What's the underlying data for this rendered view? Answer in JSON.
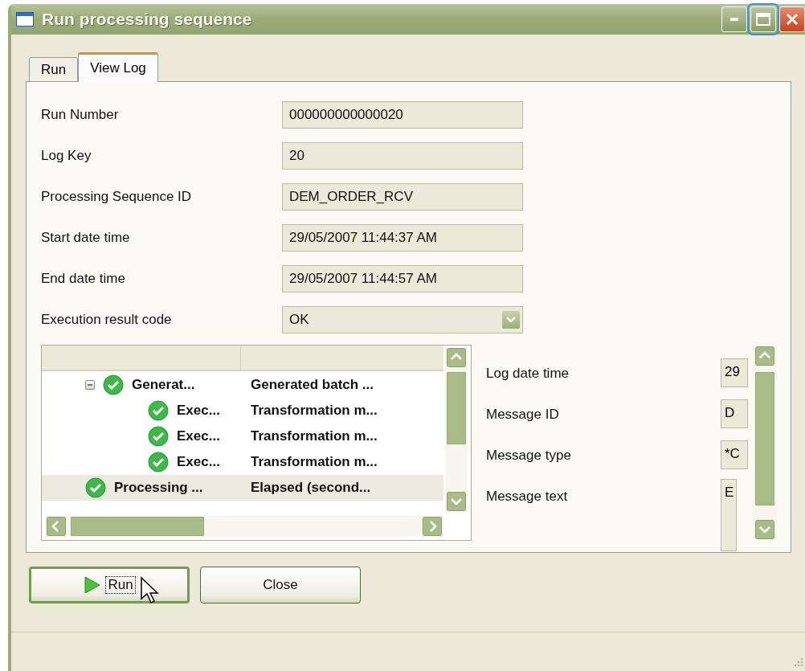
{
  "window": {
    "title": "Run processing sequence"
  },
  "tabs": [
    {
      "label": "Run",
      "selected": false
    },
    {
      "label": "View Log",
      "selected": true
    }
  ],
  "fields": [
    {
      "label": "Run Number",
      "value": "000000000000020",
      "kind": "text"
    },
    {
      "label": "Log Key",
      "value": "20",
      "kind": "text"
    },
    {
      "label": "Processing Sequence ID",
      "value": "DEM_ORDER_RCV",
      "kind": "text"
    },
    {
      "label": "Start date time",
      "value": "29/05/2007 11:44:37 AM",
      "kind": "text"
    },
    {
      "label": "End date time",
      "value": "29/05/2007 11:44:57 AM",
      "kind": "text"
    },
    {
      "label": "Execution result code",
      "value": "OK",
      "kind": "combo"
    }
  ],
  "log_tree": {
    "rows": [
      {
        "name": "Generat...",
        "message": "Generated batch ...",
        "expanded": true,
        "selected": false,
        "children": [
          {
            "name": "Exec...",
            "message": "Transformation m...",
            "selected": false
          },
          {
            "name": "Exec...",
            "message": "Transformation m...",
            "selected": false
          },
          {
            "name": "Exec...",
            "message": "Transformation m...",
            "selected": false
          }
        ]
      },
      {
        "name": "Processing ...",
        "message": "Elapsed (second...",
        "selected": true
      }
    ]
  },
  "details": [
    {
      "label": "Log date time",
      "value": "29"
    },
    {
      "label": "Message ID",
      "value": "D"
    },
    {
      "label": "Message type",
      "value": "*C"
    },
    {
      "label": "Message text",
      "value": "E",
      "kind": "multiline"
    }
  ],
  "buttons": [
    {
      "label": "Run",
      "default": true
    },
    {
      "label": "Close",
      "default": false
    }
  ]
}
